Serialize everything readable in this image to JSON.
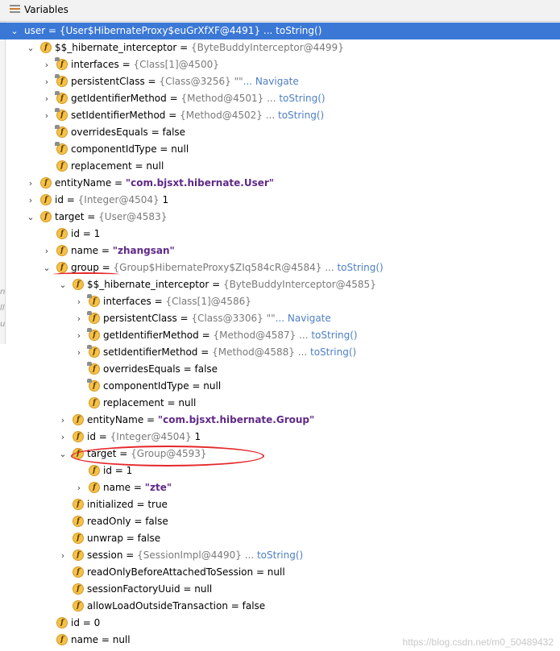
{
  "panel": {
    "title": "Variables"
  },
  "gutter": [
    "n",
    "ll",
    "u"
  ],
  "rows": [
    {
      "name": "user",
      "parts": [
        {
          "t": "user = "
        },
        {
          "t": "{User$HibernateProxy$euGrXfXF@4491}",
          "c": "ref"
        },
        {
          "t": " ... "
        },
        {
          "t": "toString()",
          "c": "link"
        }
      ],
      "expand": "open",
      "icon": "none",
      "selected": true
    },
    {
      "name": "hibernate-interceptor",
      "parts": [
        {
          "t": "$$_hibernate_interceptor = "
        },
        {
          "t": "{ByteBuddyInterceptor@4499}",
          "c": "ref"
        }
      ],
      "expand": "open",
      "icon": "f"
    },
    {
      "name": "interfaces",
      "parts": [
        {
          "t": "interfaces = "
        },
        {
          "t": "{Class[1]@4500}",
          "c": "ref"
        }
      ],
      "expand": "closed",
      "icon": "ff"
    },
    {
      "name": "persistent-class",
      "parts": [
        {
          "t": "persistentClass = "
        },
        {
          "t": "{Class@3256} \"\"",
          "c": "ref"
        },
        {
          "t": "... Navigate",
          "c": "link"
        }
      ],
      "expand": "closed",
      "icon": "ff"
    },
    {
      "name": "get-identifier-method",
      "parts": [
        {
          "t": "getIdentifierMethod = "
        },
        {
          "t": "{Method@4501} ... ",
          "c": "ref"
        },
        {
          "t": "toString()",
          "c": "link"
        }
      ],
      "expand": "closed",
      "icon": "ff"
    },
    {
      "name": "set-identifier-method",
      "parts": [
        {
          "t": "setIdentifierMethod = "
        },
        {
          "t": "{Method@4502} ... ",
          "c": "ref"
        },
        {
          "t": "toString()",
          "c": "link"
        }
      ],
      "expand": "closed",
      "icon": "ff"
    },
    {
      "name": "overrides-equals",
      "parts": [
        {
          "t": "overridesEquals = false"
        }
      ],
      "expand": "none",
      "icon": "ff"
    },
    {
      "name": "component-id-type",
      "parts": [
        {
          "t": "componentIdType = null"
        }
      ],
      "expand": "none",
      "icon": "ff"
    },
    {
      "name": "replacement",
      "parts": [
        {
          "t": "replacement = null"
        }
      ],
      "expand": "none",
      "icon": "f"
    },
    {
      "name": "entity-name",
      "parts": [
        {
          "t": "entityName = "
        },
        {
          "t": "\"com.bjsxt.hibernate.User\"",
          "c": "str"
        }
      ],
      "expand": "closed",
      "icon": "f"
    },
    {
      "name": "id",
      "parts": [
        {
          "t": "id = "
        },
        {
          "t": "{Integer@4504}",
          "c": "ref"
        },
        {
          "t": " 1"
        }
      ],
      "expand": "closed",
      "icon": "f"
    },
    {
      "name": "target",
      "parts": [
        {
          "t": "target = "
        },
        {
          "t": "{User@4583}",
          "c": "ref"
        }
      ],
      "expand": "open",
      "icon": "f"
    },
    {
      "name": "user-id",
      "parts": [
        {
          "t": "id = 1"
        }
      ],
      "expand": "none",
      "icon": "f"
    },
    {
      "name": "user-name",
      "parts": [
        {
          "t": "name = "
        },
        {
          "t": "\"zhangsan\"",
          "c": "str"
        }
      ],
      "expand": "closed",
      "icon": "f"
    },
    {
      "name": "group",
      "parts": [
        {
          "t": "group = "
        },
        {
          "t": "{Group$HibernateProxy$ZIq584cR@4584} ... ",
          "c": "ref"
        },
        {
          "t": "toString()",
          "c": "link"
        }
      ],
      "expand": "open",
      "icon": "f"
    },
    {
      "name": "group-hibernate-interceptor",
      "parts": [
        {
          "t": "$$_hibernate_interceptor = "
        },
        {
          "t": "{ByteBuddyInterceptor@4585}",
          "c": "ref"
        }
      ],
      "expand": "open",
      "icon": "f"
    },
    {
      "name": "group-interfaces",
      "parts": [
        {
          "t": "interfaces = "
        },
        {
          "t": "{Class[1]@4586}",
          "c": "ref"
        }
      ],
      "expand": "closed",
      "icon": "ff"
    },
    {
      "name": "group-persistent-class",
      "parts": [
        {
          "t": "persistentClass = "
        },
        {
          "t": "{Class@3306} \"\"",
          "c": "ref"
        },
        {
          "t": "... Navigate",
          "c": "link"
        }
      ],
      "expand": "closed",
      "icon": "ff"
    },
    {
      "name": "group-get-identifier-method",
      "parts": [
        {
          "t": "getIdentifierMethod = "
        },
        {
          "t": "{Method@4587} ... ",
          "c": "ref"
        },
        {
          "t": "toString()",
          "c": "link"
        }
      ],
      "expand": "closed",
      "icon": "ff"
    },
    {
      "name": "group-set-identifier-method",
      "parts": [
        {
          "t": "setIdentifierMethod = "
        },
        {
          "t": "{Method@4588} ... ",
          "c": "ref"
        },
        {
          "t": "toString()",
          "c": "link"
        }
      ],
      "expand": "closed",
      "icon": "ff"
    },
    {
      "name": "group-overrides-equals",
      "parts": [
        {
          "t": "overridesEquals = false"
        }
      ],
      "expand": "none",
      "icon": "ff"
    },
    {
      "name": "group-component-id-type",
      "parts": [
        {
          "t": "componentIdType = null"
        }
      ],
      "expand": "none",
      "icon": "ff"
    },
    {
      "name": "group-replacement",
      "parts": [
        {
          "t": "replacement = null"
        }
      ],
      "expand": "none",
      "icon": "f"
    },
    {
      "name": "group-entity-name",
      "parts": [
        {
          "t": "entityName = "
        },
        {
          "t": "\"com.bjsxt.hibernate.Group\"",
          "c": "str"
        }
      ],
      "expand": "closed",
      "icon": "f"
    },
    {
      "name": "group-id",
      "parts": [
        {
          "t": "id = "
        },
        {
          "t": "{Integer@4504}",
          "c": "ref"
        },
        {
          "t": " 1"
        }
      ],
      "expand": "closed",
      "icon": "f"
    },
    {
      "name": "group-target",
      "parts": [
        {
          "t": "target = "
        },
        {
          "t": "{Group@4593}",
          "c": "ref"
        }
      ],
      "expand": "open",
      "icon": "f"
    },
    {
      "name": "group-target-id",
      "parts": [
        {
          "t": "id = 1"
        }
      ],
      "expand": "none",
      "icon": "f"
    },
    {
      "name": "group-target-name",
      "parts": [
        {
          "t": "name = "
        },
        {
          "t": "\"zte\"",
          "c": "str"
        }
      ],
      "expand": "closed",
      "icon": "f"
    },
    {
      "name": "initialized",
      "parts": [
        {
          "t": "initialized = true"
        }
      ],
      "expand": "none",
      "icon": "f"
    },
    {
      "name": "read-only",
      "parts": [
        {
          "t": "readOnly = false"
        }
      ],
      "expand": "none",
      "icon": "f"
    },
    {
      "name": "unwrap",
      "parts": [
        {
          "t": "unwrap = false"
        }
      ],
      "expand": "none",
      "icon": "f"
    },
    {
      "name": "session",
      "parts": [
        {
          "t": "session = "
        },
        {
          "t": "{SessionImpl@4490} ... ",
          "c": "ref"
        },
        {
          "t": "toString()",
          "c": "link"
        }
      ],
      "expand": "closed",
      "icon": "f"
    },
    {
      "name": "read-only-before-attached",
      "parts": [
        {
          "t": "readOnlyBeforeAttachedToSession = null"
        }
      ],
      "expand": "none",
      "icon": "f"
    },
    {
      "name": "session-factory-uuid",
      "parts": [
        {
          "t": "sessionFactoryUuid = null"
        }
      ],
      "expand": "none",
      "icon": "f"
    },
    {
      "name": "allow-load-outside-transaction",
      "parts": [
        {
          "t": "allowLoadOutsideTransaction = false"
        }
      ],
      "expand": "none",
      "icon": "f"
    },
    {
      "name": "group-own-id",
      "parts": [
        {
          "t": "id = 0"
        }
      ],
      "expand": "none",
      "icon": "f"
    },
    {
      "name": "group-own-name",
      "parts": [
        {
          "t": "name = null"
        }
      ],
      "expand": "none",
      "icon": "f"
    }
  ],
  "watermark": "https://blog.csdn.net/m0_50489432"
}
